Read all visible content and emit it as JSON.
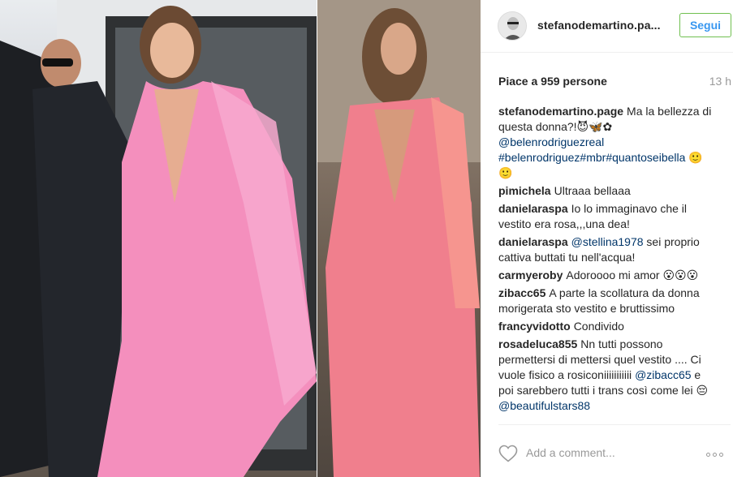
{
  "post": {
    "username": "stefanodemartino.pa...",
    "follow_label": "Segui",
    "likes": "Piace a 959 persone",
    "timestamp": "13 h"
  },
  "comments": [
    {
      "author": "stefanodemartino.page",
      "parts": [
        {
          "t": "Ma la bellezza di questa donna?!😈🦋✿ "
        },
        {
          "t": "@belenrodriguezreal",
          "link": true
        },
        {
          "t": " "
        },
        {
          "t": "#belenrodriguez",
          "link": true
        },
        {
          "t": "#mbr",
          "link": true
        },
        {
          "t": "#quantoseibella",
          "link": true
        },
        {
          "t": " 🙂 🙂"
        }
      ]
    },
    {
      "author": "pimichela",
      "parts": [
        {
          "t": "Ultraaa bellaaa"
        }
      ]
    },
    {
      "author": "danielaraspa",
      "parts": [
        {
          "t": "Io lo immaginavo che il vestito era rosa,,,una dea!"
        }
      ]
    },
    {
      "author": "danielaraspa",
      "parts": [
        {
          "t": "@stellina1978",
          "link": true
        },
        {
          "t": " sei proprio cattiva buttati tu nell'acqua!"
        }
      ]
    },
    {
      "author": "carmyeroby",
      "parts": [
        {
          "t": "Adoroooo mi amor 😮😮😮"
        }
      ]
    },
    {
      "author": "zibacc65",
      "parts": [
        {
          "t": "A parte la scollatura da donna morigerata sto vestito e bruttissimo"
        }
      ]
    },
    {
      "author": "francyvidotto",
      "parts": [
        {
          "t": "Condivido"
        }
      ]
    },
    {
      "author": "rosadeluca855",
      "parts": [
        {
          "t": "Nn tutti possono permettersi di mettersi quel vestito .... Ci vuole fisico a rosiconiiiiiiiiiii "
        },
        {
          "t": "@zibacc65",
          "link": true
        },
        {
          "t": " e poi sarebbero tutti i trans così come lei 😔 "
        },
        {
          "t": "@beautifulstars88",
          "link": true
        }
      ]
    }
  ],
  "composer": {
    "placeholder": "Add a comment..."
  }
}
